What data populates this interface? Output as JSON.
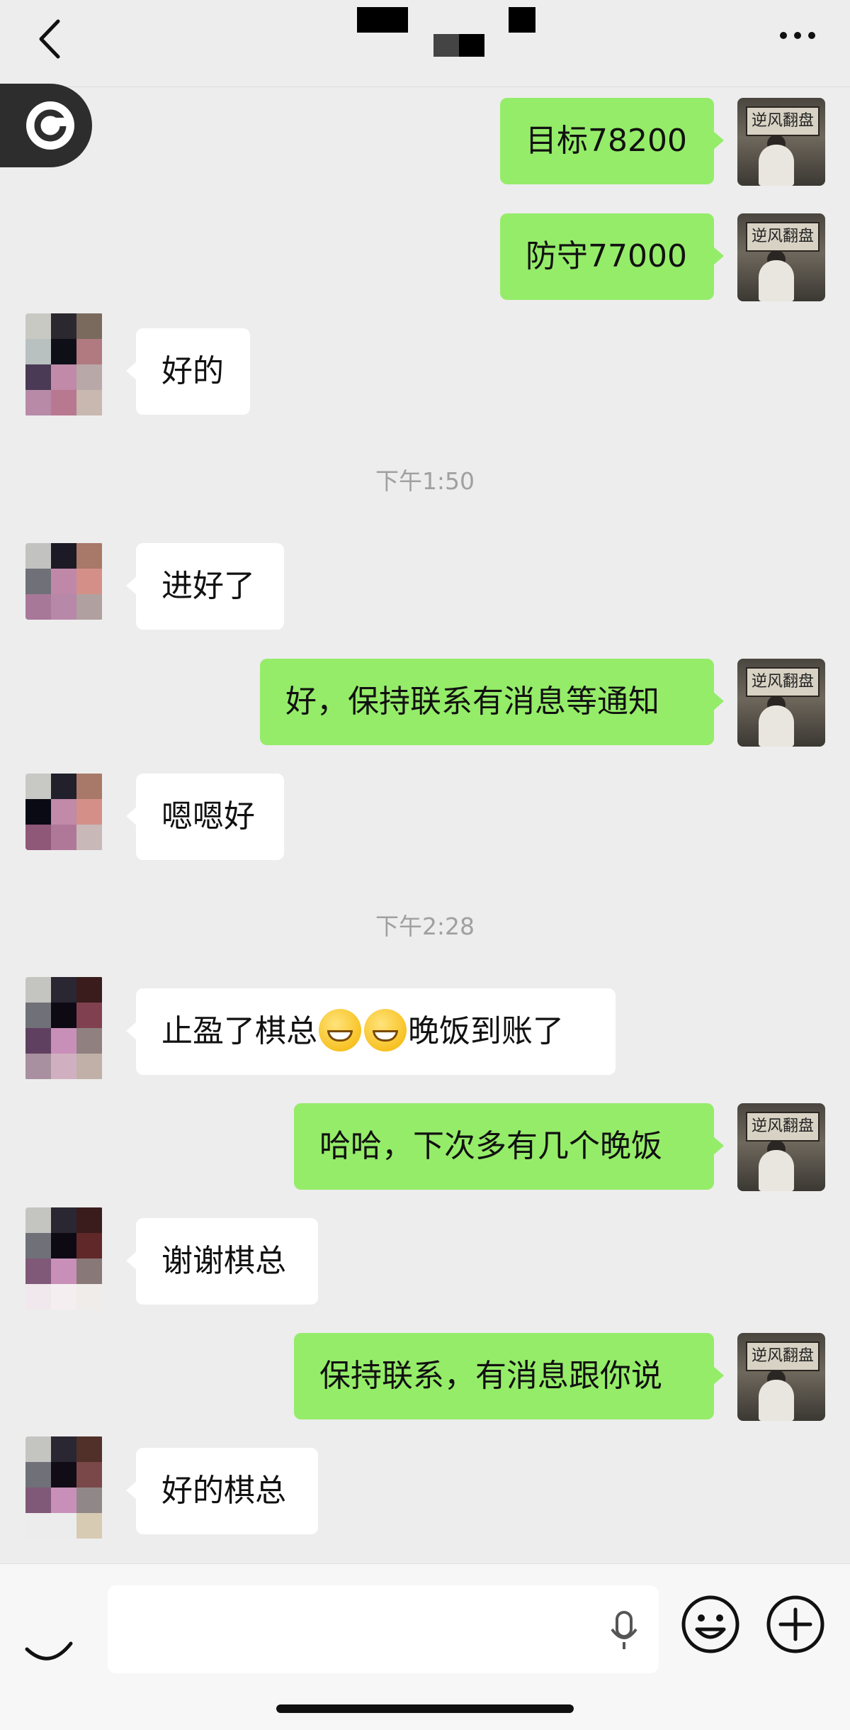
{
  "header": {
    "back_icon": "chevron-left-icon",
    "more_icon": "more-dots-icon"
  },
  "timestamps": [
    "下午1:50",
    "下午2:28"
  ],
  "messages": [
    {
      "side": "out",
      "text": "目标78200"
    },
    {
      "side": "out",
      "text": "防守77000"
    },
    {
      "side": "in",
      "text": "好的"
    },
    {
      "side": "in",
      "text": "进好了"
    },
    {
      "side": "out",
      "text": "好，保持联系有消息等通知"
    },
    {
      "side": "in",
      "text": "嗯嗯好"
    },
    {
      "side": "in",
      "text_before": "止盈了棋总",
      "text_after": "晚饭到账了",
      "emoji": "grinning-face-emoji"
    },
    {
      "side": "out",
      "text": "哈哈，下次多有几个晚饭"
    },
    {
      "side": "in",
      "text": "谢谢棋总"
    },
    {
      "side": "out",
      "text": "保持联系，有消息跟你说"
    },
    {
      "side": "in",
      "text": "好的棋总"
    }
  ],
  "self_avatar": {
    "plaque_text": "逆风翻盘"
  },
  "input_bar": {
    "icons": [
      "voice-icon",
      "mic-icon",
      "emoji-icon",
      "plus-icon"
    ]
  },
  "colors": {
    "outgoing_bubble": "#95ec69",
    "incoming_bubble": "#ffffff",
    "background": "#ededed"
  }
}
